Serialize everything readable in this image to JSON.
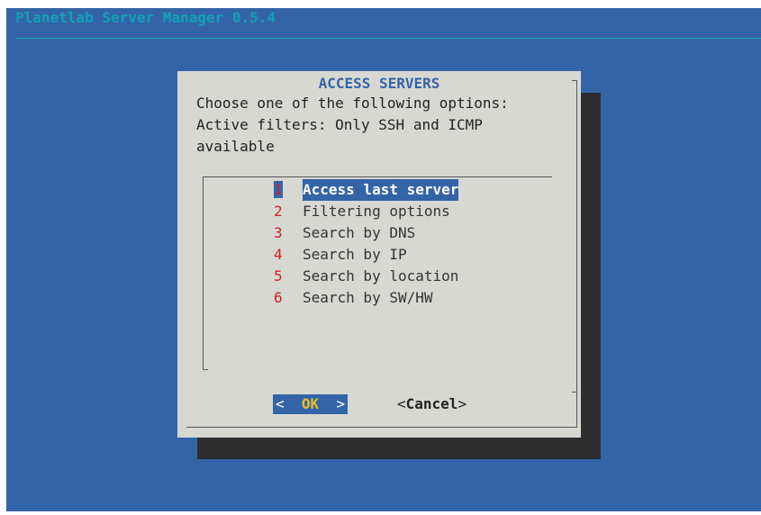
{
  "backtitle": "Planetlab Server Manager 0.5.4",
  "dialog": {
    "title": "ACCESS SERVERS",
    "prompt_lines": [
      "Choose one of the following options:",
      "Active filters: Only SSH and ICMP",
      "available"
    ],
    "menu": [
      {
        "key": "1",
        "label": "Access last server",
        "selected": true
      },
      {
        "key": "2",
        "label": "Filtering options"
      },
      {
        "key": "3",
        "label": "Search by DNS"
      },
      {
        "key": "4",
        "label": "Search by IP"
      },
      {
        "key": "5",
        "label": "Search by location"
      },
      {
        "key": "6",
        "label": "Search by SW/HW"
      }
    ],
    "ok_left": "<",
    "ok_label": "OK",
    "ok_right": ">",
    "cancel_left": "<",
    "cancel_label": "Cancel",
    "cancel_right": ">"
  },
  "colors": {
    "background": "#3464a8",
    "dialog": "#d8d8d2",
    "title": "#3464a8",
    "hotkey": "#cc2222",
    "selection": "#3464a8",
    "ok_key": "#e8c020"
  }
}
